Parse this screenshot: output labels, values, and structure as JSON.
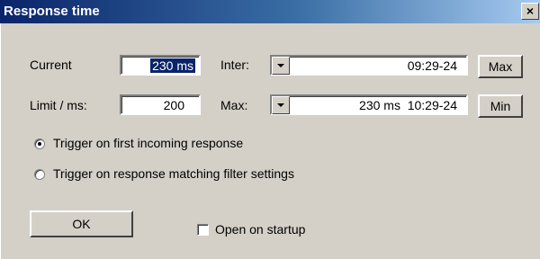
{
  "window": {
    "title": "Response time",
    "close_glyph": "×"
  },
  "current": {
    "label": "Current",
    "value": "230 ms"
  },
  "limit": {
    "label": "Limit / ms:",
    "value": "200"
  },
  "inter": {
    "label": "Inter:",
    "value": "09:29-24"
  },
  "max": {
    "label": "Max:",
    "value": "230 ms  10:29-24"
  },
  "buttons": {
    "max_label": "Max",
    "min_label": "Min",
    "ok_label": "OK"
  },
  "trigger": {
    "options": [
      {
        "label": "Trigger on first incoming response",
        "checked": true
      },
      {
        "label": "Trigger on response matching filter settings",
        "checked": false
      }
    ]
  },
  "startup": {
    "label": "Open on startup",
    "checked": false
  },
  "colors": {
    "title_start": "#0a246a",
    "title_end": "#a6caf0",
    "face": "#d4d0c8",
    "selection": "#0a246a"
  }
}
